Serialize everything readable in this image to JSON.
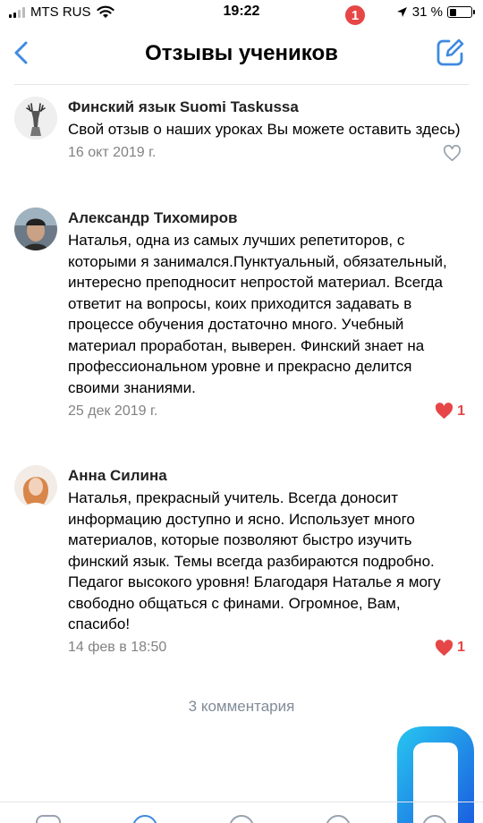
{
  "status_bar": {
    "carrier": "MTS RUS",
    "time": "19:22",
    "battery_percent": "31 %",
    "battery_level": 0.31
  },
  "nav": {
    "title": "Отзывы учеников",
    "back_icon": "chevron-left-icon",
    "compose_icon": "compose-icon",
    "accent_color": "#3f8ae0"
  },
  "comments": [
    {
      "author": "Финский язык Suomi Taskussa",
      "text": "Свой отзыв о наших уроках Вы можете оставить здесь)",
      "date": "16 окт 2019 г.",
      "likes": "",
      "liked": false,
      "avatar": "deer-avatar-icon"
    },
    {
      "author": "Александр Тихомиров",
      "text": "Наталья, одна из самых лучших репетиторов, с которыми я занимался.Пунктуальный, обязательный, интересно преподносит непростой материал. Всегда ответит на вопросы, коих приходится задавать в процессе обучения достаточно много. Учебный материал проработан, выверен. Финский знает на профессиональном уровне и прекрасно делится своими знаниями.",
      "date": "25 дек 2019 г.",
      "likes": "1",
      "liked": true,
      "avatar": "user-photo-avatar"
    },
    {
      "author": "Анна Силина",
      "text": "Наталья, прекрасный учитель. Всегда доносит информацию доступно и ясно. Использует много материалов, которые позволяют быстро изучить финский язык. Темы всегда разбираются подробно. Педагог высокого уровня! Благодаря Наталье я могу свободно общаться с финами. Огромное, Вам, спасибо!",
      "date": "14 фев в 18:50",
      "likes": "1",
      "liked": true,
      "avatar": "user-photo-avatar"
    }
  ],
  "more_comments_label": "3 комментария",
  "tabbar": {
    "badge_count": "1",
    "badge_color": "#e64646"
  },
  "colors": {
    "like": "#e64646",
    "muted": "#828282",
    "link": "#818c99"
  }
}
